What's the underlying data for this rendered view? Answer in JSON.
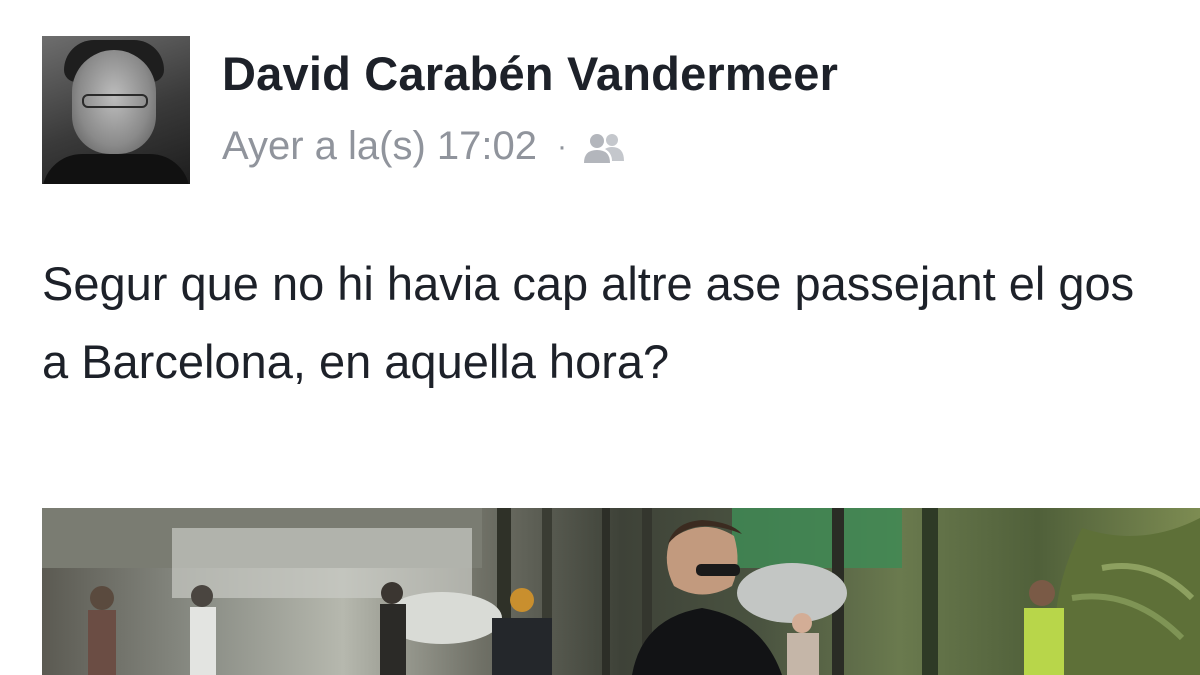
{
  "post": {
    "author": "David Carabén Vandermeer",
    "timestamp": "Ayer a la(s) 17:02",
    "separator": "·",
    "audience_icon": "friends-icon",
    "text": "Segur que no hi havia cap altre ase passejant el gos a Barcelona, en aquella hora?"
  },
  "colors": {
    "author": "#1d2129",
    "meta": "#90949c",
    "text": "#1d2129"
  }
}
